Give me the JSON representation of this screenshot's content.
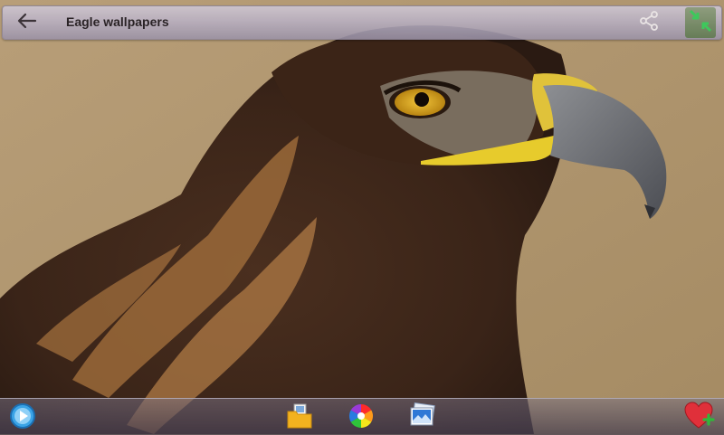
{
  "app": {
    "title": "Eagle wallpapers"
  },
  "colors": {
    "topbar": "#b9b1c4",
    "bottombar": "#6f6680",
    "fullscreen_accent": "#2fd05a",
    "favorite_red": "#e0303a"
  },
  "icons": {
    "back": "arrow-left-icon",
    "share": "share-icon",
    "fullscreen": "fullscreen-toggle-icon",
    "play": "play-slideshow-icon",
    "folder": "folder-icon",
    "color": "color-wheel-icon",
    "gallery": "gallery-icon",
    "favorite": "add-favorite-icon"
  }
}
